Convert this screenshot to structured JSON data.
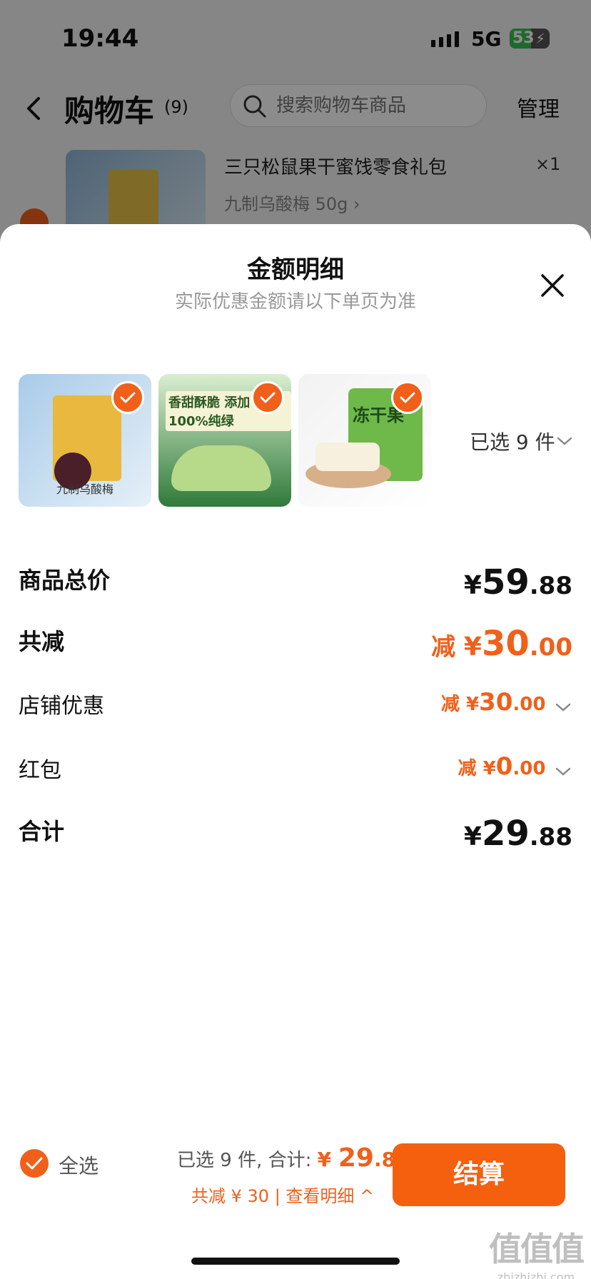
{
  "status_bar": {
    "time": "19:44",
    "network": "5G",
    "battery": "53",
    "battery_level": 0.53
  },
  "nav": {
    "title": "购物车",
    "count": "(9)",
    "search_placeholder": "搜索购物车商品",
    "manage": "管理"
  },
  "cart_item": {
    "name": "三只松鼠果干蜜饯零食礼包",
    "spec": "九制乌酸梅 50g ›",
    "qty": "×1"
  },
  "sheet": {
    "title": "金额明细",
    "subtitle": "实际优惠金额请以下单页为准",
    "thumbnails": [
      {
        "caption": "九制乌酸梅"
      },
      {
        "caption": "香甜酥脆 添加100%纯绿"
      },
      {
        "caption": "冻干果"
      }
    ],
    "selected_count": "已选 9 件",
    "rows": [
      {
        "label": "商品总价",
        "prefix": "",
        "yen": "¥",
        "int": "59",
        "dec": ".88"
      },
      {
        "label": "共减",
        "prefix": "减 ",
        "yen": "¥",
        "int": "30",
        "dec": ".00"
      },
      {
        "label": "店铺优惠",
        "prefix": "减 ",
        "yen": "¥",
        "int": "30",
        "dec": ".00"
      },
      {
        "label": "红包",
        "prefix": "减 ",
        "yen": "¥",
        "int": "0",
        "dec": ".00"
      },
      {
        "label": "合计",
        "prefix": "",
        "yen": "¥",
        "int": "29",
        "dec": ".88"
      }
    ]
  },
  "bottom_bar": {
    "select_all": "全选",
    "summary_prefix": "已选 9 件, 合计: ",
    "total_yen": "¥ ",
    "total_int": "29",
    "total_dec": ".88",
    "discount_text": "共减 ¥ 30 | 查看明细 ^",
    "checkout": "结算"
  },
  "watermark": {
    "main": "值值值",
    "sub": "zhizhizhi.com"
  },
  "colors": {
    "accent": "#f0601a",
    "sheet_bg": "#ffffff",
    "dim": "rgba(0,0,0,0.45)"
  }
}
